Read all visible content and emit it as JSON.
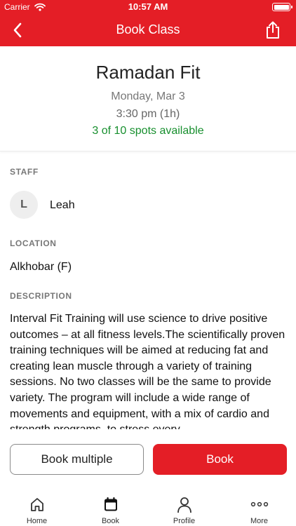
{
  "status_bar": {
    "carrier": "Carrier",
    "time": "10:57 AM"
  },
  "nav": {
    "title": "Book Class",
    "back_icon": "chevron-left-icon",
    "share_icon": "share-icon"
  },
  "class_info": {
    "name": "Ramadan Fit",
    "date": "Monday, Mar 3",
    "time": "3:30 pm (1h)",
    "spots": "3 of 10 spots available"
  },
  "staff": {
    "label": "STAFF",
    "initial": "L",
    "name": "Leah"
  },
  "location": {
    "label": "LOCATION",
    "value": "Alkhobar (F)"
  },
  "description": {
    "label": "DESCRIPTION",
    "text": "Interval Fit Training will use science to drive positive outcomes – at all fitness levels.The scientifically proven training techniques will be aimed at reducing fat and creating lean muscle through a variety of training sessions. No two classes will be the same to provide variety. The program will include a wide range of movements and equipment, with a mix of cardio and strength programs, to stress every"
  },
  "actions": {
    "book_multiple": "Book multiple",
    "book": "Book"
  },
  "tabs": [
    {
      "label": "Home",
      "icon": "home-icon"
    },
    {
      "label": "Book",
      "icon": "calendar-icon"
    },
    {
      "label": "Profile",
      "icon": "person-icon"
    },
    {
      "label": "More",
      "icon": "more-dots-icon"
    }
  ],
  "colors": {
    "brand": "#e41e26",
    "available": "#178f2e"
  }
}
